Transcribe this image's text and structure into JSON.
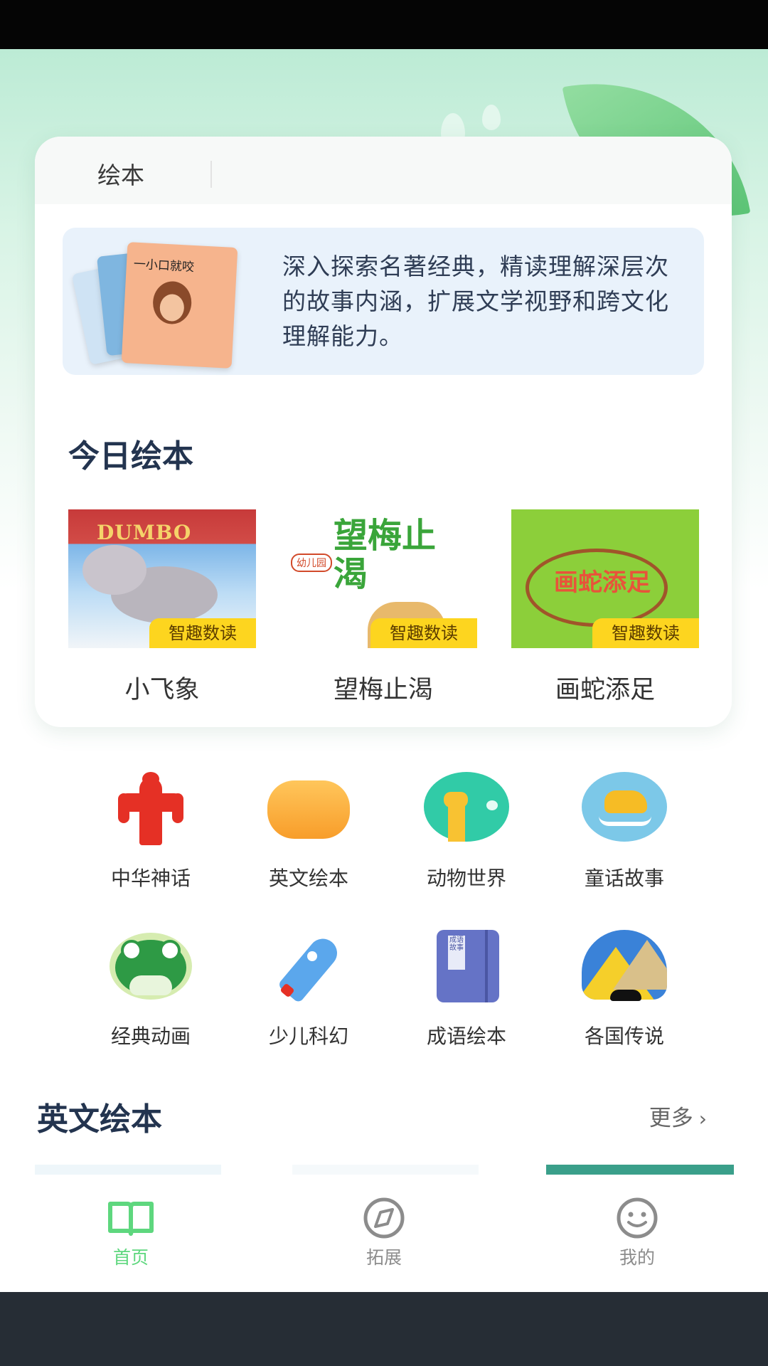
{
  "tabs": {
    "active_label": "绘本"
  },
  "intro": {
    "book_title": "一小口就咬",
    "text": "深入探索名著经典，精读理解深层次的故事内涵，扩展文学视野和跨文化理解能力。"
  },
  "today": {
    "title": "今日绘本",
    "books": [
      {
        "title": "小飞象",
        "cover_text": "DUMBO",
        "badge": "智趣数读"
      },
      {
        "title": "望梅止渴",
        "cover_text": "望梅止渴",
        "badge": "智趣数读",
        "cover_tag": "幼儿园"
      },
      {
        "title": "画蛇添足",
        "cover_text": "画蛇添足",
        "badge": "智趣数读"
      }
    ]
  },
  "categories": [
    {
      "label": "中华神话",
      "icon": "red-figure-icon"
    },
    {
      "label": "英文绘本",
      "icon": "orange-sofa-icon"
    },
    {
      "label": "动物世界",
      "icon": "giraffe-icon"
    },
    {
      "label": "童话故事",
      "icon": "rocking-horse-icon"
    },
    {
      "label": "经典动画",
      "icon": "frog-icon"
    },
    {
      "label": "少儿科幻",
      "icon": "rocket-icon"
    },
    {
      "label": "成语绘本",
      "icon": "idiom-book-icon",
      "book_text": "成语故事"
    },
    {
      "label": "各国传说",
      "icon": "pyramid-camel-icon"
    }
  ],
  "english": {
    "title": "英文绘本",
    "more": "更多"
  },
  "nav": [
    {
      "label": "首页",
      "icon": "book-open-icon",
      "active": true
    },
    {
      "label": "拓展",
      "icon": "compass-icon",
      "active": false
    },
    {
      "label": "我的",
      "icon": "smile-face-icon",
      "active": false
    }
  ],
  "colors": {
    "nav_active": "#5ed77e",
    "nav_inactive": "#8c8c8c",
    "badge": "#fdd51f",
    "heading": "#23344f",
    "accent_strip": "#3a9f8a"
  }
}
